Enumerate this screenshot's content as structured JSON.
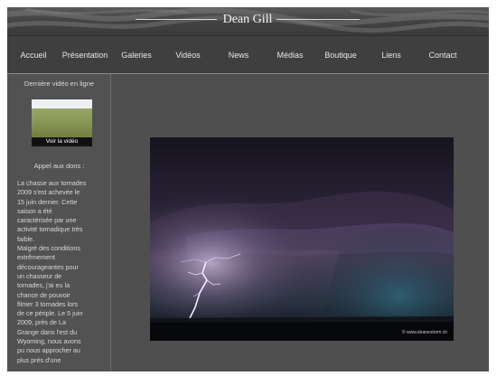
{
  "header": {
    "logo_text": "Dean Gill"
  },
  "nav": {
    "items": [
      {
        "label": "Accueil"
      },
      {
        "label": "Présentation"
      },
      {
        "label": "Galeries"
      },
      {
        "label": "Vidéos"
      },
      {
        "label": "News"
      },
      {
        "label": "Médias"
      },
      {
        "label": "Boutique"
      },
      {
        "label": "Liens"
      },
      {
        "label": "Contact"
      }
    ]
  },
  "sidebar": {
    "video_heading": "Dernière vidéo en ligne",
    "video_caption": "Voir la vidéo",
    "donate_heading": "Appel aux dons :",
    "text_lines": [
      "La chasse aux tornades",
      "2009 s'est achevée le",
      "15 juin dernier. Cette",
      "saison a été",
      "caractérisée par une",
      "activité tornadique très",
      "faible.",
      "Malgré des conditions",
      "extrêmement",
      "décourageantes pour",
      "un chasseur de",
      "tornades, j'ai eu la",
      "chance de pouvoir",
      "filmer 3 tornades lors",
      "de ce périple. Le 5 juin",
      "2009, près de La",
      "Grange dans l'est du",
      "Wyoming, nous avons",
      "pu nous approcher au",
      "plus près d'une"
    ]
  },
  "main": {
    "photo_credit": "© www.deanestorm.ch"
  },
  "colors": {
    "frame_bg": "#4e4e4e",
    "nav_bg": "#3f3f3f",
    "text_light": "#e6e6e6"
  }
}
